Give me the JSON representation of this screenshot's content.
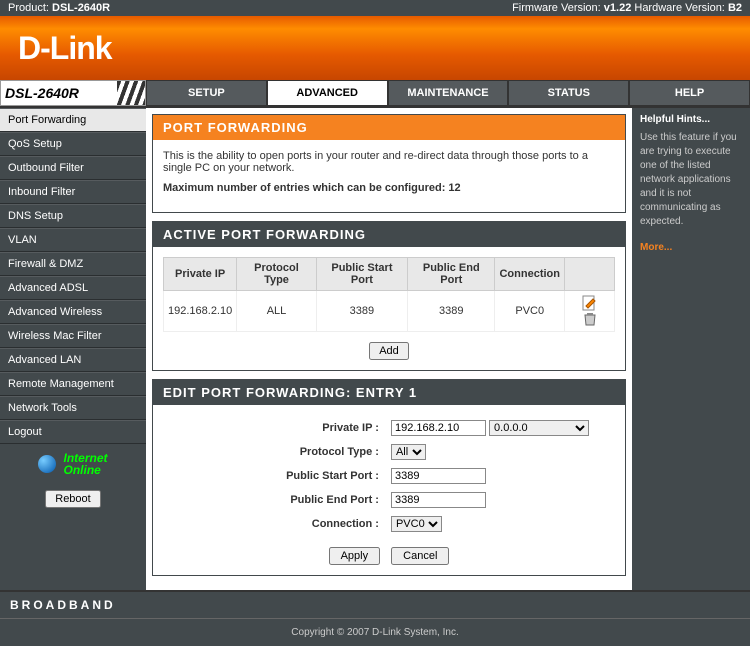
{
  "topbar": {
    "product_label": "Product:",
    "product": "DSL-2640R",
    "firmware_label": "Firmware Version:",
    "firmware": "v1.22",
    "hardware_label": "Hardware Version:",
    "hardware": "B2"
  },
  "logo": "D-Link",
  "model": "DSL-2640R",
  "nav": {
    "setup": "SETUP",
    "advanced": "ADVANCED",
    "maintenance": "MAINTENANCE",
    "status": "STATUS",
    "help": "HELP"
  },
  "sidebar": {
    "items": [
      "Port Forwarding",
      "QoS Setup",
      "Outbound Filter",
      "Inbound Filter",
      "DNS Setup",
      "VLAN",
      "Firewall & DMZ",
      "Advanced ADSL",
      "Advanced Wireless",
      "Wireless Mac Filter",
      "Advanced LAN",
      "Remote Management",
      "Network Tools",
      "Logout"
    ],
    "internet_l1": "Internet",
    "internet_l2": "Online",
    "reboot": "Reboot"
  },
  "port_forwarding": {
    "title": "PORT FORWARDING",
    "desc": "This is the ability to open ports in your router and re-direct data through those ports to a single PC on your network.",
    "max_label": "Maximum number of entries which can be configured: 12"
  },
  "active": {
    "title": "ACTIVE PORT FORWARDING",
    "headers": {
      "private_ip": "Private IP",
      "protocol": "Protocol Type",
      "start": "Public Start Port",
      "end": "Public End Port",
      "conn": "Connection"
    },
    "rows": [
      {
        "ip": "192.168.2.10",
        "protocol": "ALL",
        "start": "3389",
        "end": "3389",
        "conn": "PVC0"
      }
    ],
    "add": "Add"
  },
  "edit": {
    "title": "EDIT PORT FORWARDING: ENTRY 1",
    "labels": {
      "private_ip": "Private IP :",
      "protocol": "Protocol Type :",
      "start": "Public Start Port :",
      "end": "Public End Port :",
      "conn": "Connection :"
    },
    "values": {
      "private_ip": "192.168.2.10",
      "ip_select": "0.0.0.0",
      "protocol": "All",
      "start": "3389",
      "end": "3389",
      "conn": "PVC0"
    },
    "apply": "Apply",
    "cancel": "Cancel"
  },
  "hints": {
    "title": "Helpful Hints...",
    "text": "Use this feature if you are trying to execute one of the listed network applications and it is not communicating as expected.",
    "more": "More..."
  },
  "broadband": "BROADBAND",
  "copyright": "Copyright © 2007 D-Link System, Inc."
}
